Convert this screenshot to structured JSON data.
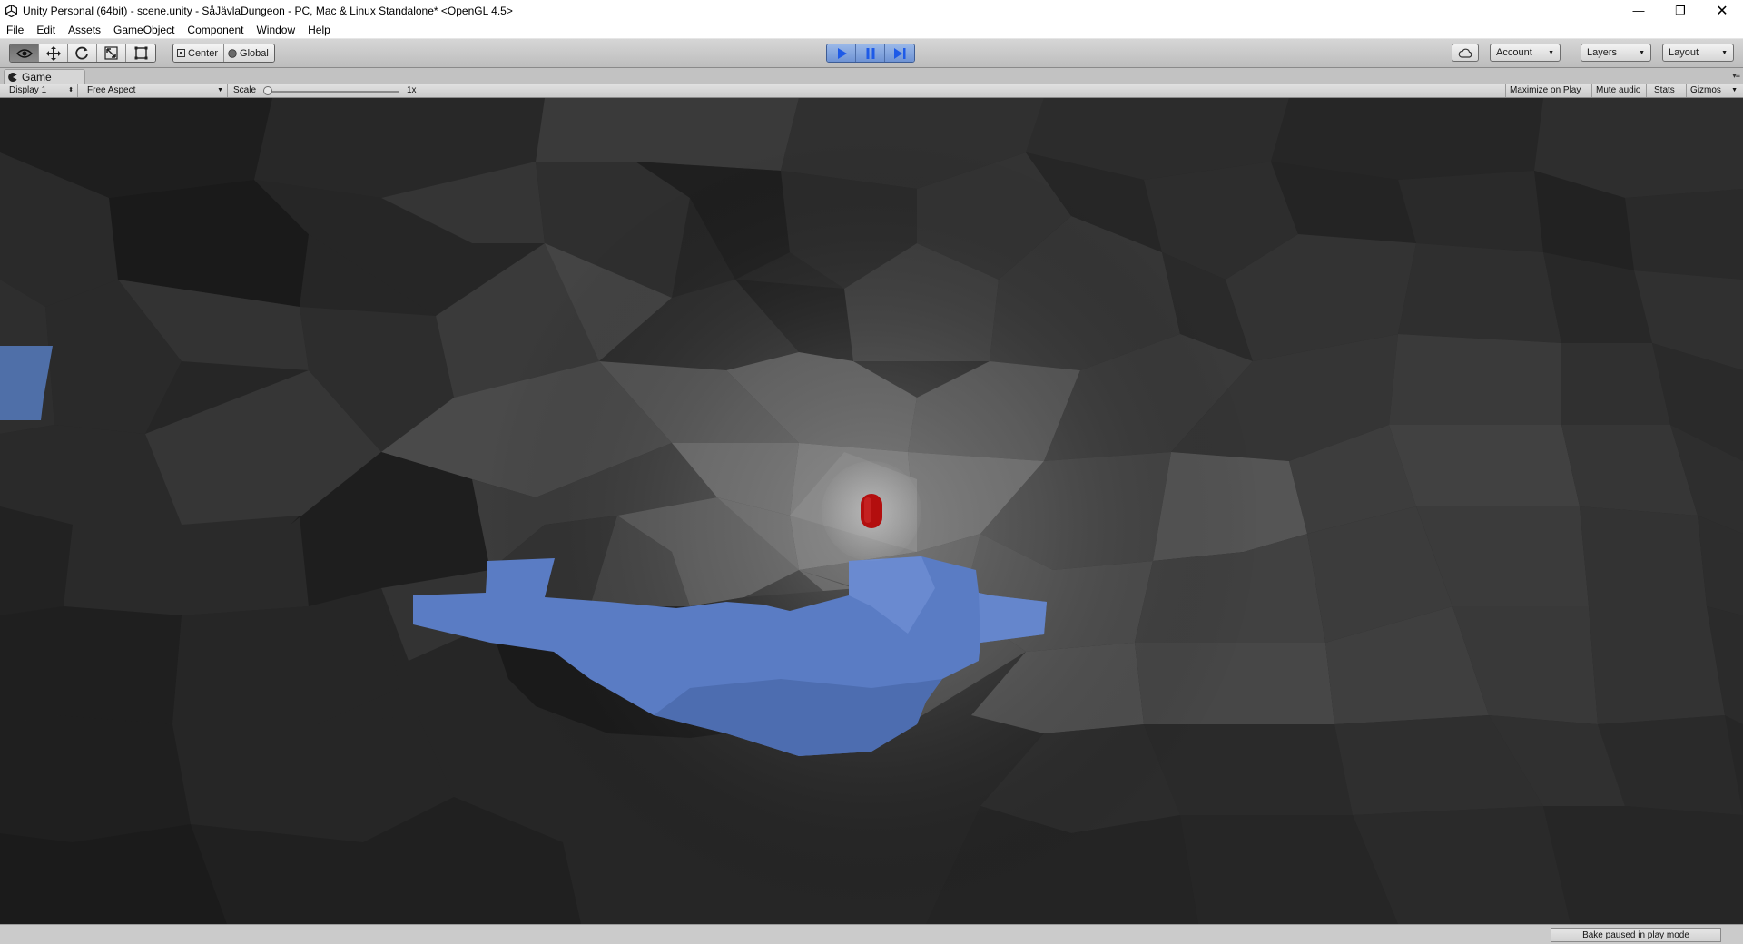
{
  "window": {
    "title": "Unity Personal (64bit) - scene.unity - SåJävlaDungeon - PC, Mac & Linux Standalone* <OpenGL 4.5>",
    "minimize_glyph": "—",
    "maximize_glyph": "❐",
    "close_glyph": "✕"
  },
  "menu": [
    "File",
    "Edit",
    "Assets",
    "GameObject",
    "Component",
    "Window",
    "Help"
  ],
  "toolbar": {
    "transform_tools": [
      "view-tool",
      "move-tool",
      "rotate-tool",
      "scale-tool",
      "rect-tool"
    ],
    "pivot_label": "Center",
    "space_label": "Global",
    "play_controls": [
      "play",
      "pause",
      "step"
    ],
    "account_label": "Account",
    "layers_label": "Layers",
    "layout_label": "Layout"
  },
  "game_tab": {
    "label": "Game",
    "display": "Display 1",
    "aspect": "Free Aspect",
    "scale_label": "Scale",
    "scale_value": "1x",
    "maximize_label": "Maximize on Play",
    "mute_label": "Mute audio",
    "stats_label": "Stats",
    "gizmos_label": "Gizmos"
  },
  "status": {
    "bake": "Bake paused in play mode"
  },
  "colors": {
    "play_accent": "#6f93d4",
    "water": "#5a7cc4",
    "player": "#b30e0e"
  }
}
